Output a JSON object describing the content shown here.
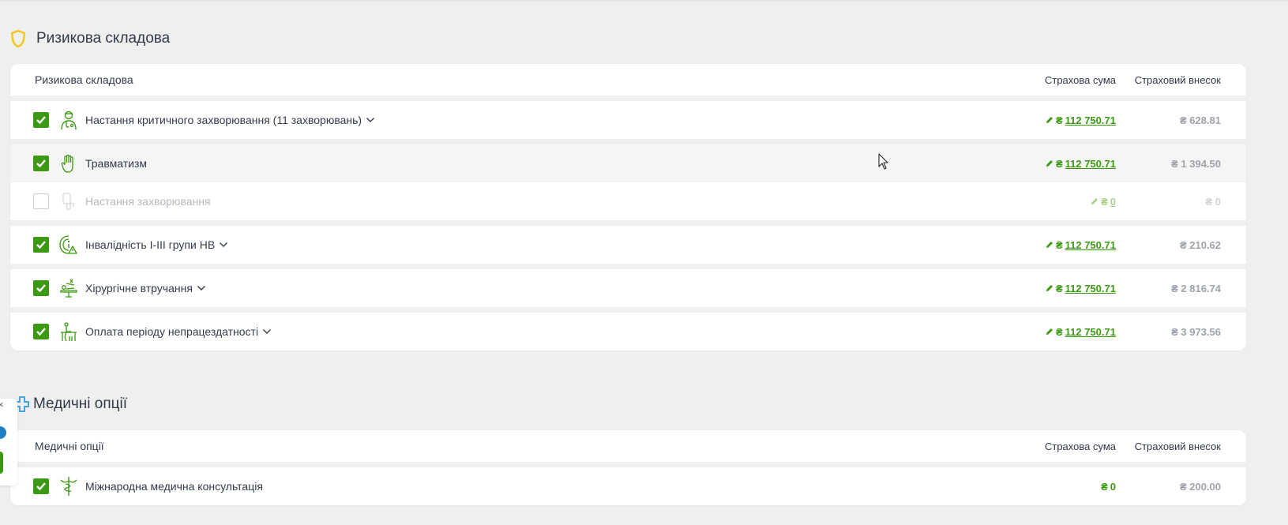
{
  "colors": {
    "accent": "#3b9a12",
    "muted": "#9ea3aa",
    "shield": "#f5c518",
    "cross": "#4aa3df"
  },
  "risk": {
    "title": "Ризикова складова",
    "header": {
      "name": "Ризикова складова",
      "sum": "Страхова сума",
      "fee": "Страховий внесок"
    },
    "rows": [
      {
        "label": "Настання критичного захворювання (11 захворювань)",
        "checked": true,
        "icon": "doctor-icon",
        "sum": "112 750.71",
        "fee": "628.81",
        "expandable": true
      },
      {
        "label": "Травматизм",
        "checked": true,
        "icon": "hand-icon",
        "sum": "112 750.71",
        "fee": "1 394.50",
        "expandable": false
      },
      {
        "label": "Настання захворювання",
        "checked": false,
        "icon": "medical-icon",
        "sum": "0",
        "fee": "0",
        "expandable": false
      },
      {
        "label": "Інвалідність I-III групи НВ",
        "checked": true,
        "icon": "disability-icon",
        "sum": "112 750.71",
        "fee": "210.62",
        "expandable": true
      },
      {
        "label": "Хірургічне втручання",
        "checked": true,
        "icon": "surgery-icon",
        "sum": "112 750.71",
        "fee": "2 816.74",
        "expandable": true
      },
      {
        "label": "Оплата періоду непрацездатності",
        "checked": true,
        "icon": "sick-leave-icon",
        "sum": "112 750.71",
        "fee": "3 973.56",
        "expandable": true
      }
    ]
  },
  "medical": {
    "title": "Медичні опції",
    "header": {
      "name": "Медичні опції",
      "sum": "Страхова сума",
      "fee": "Страховий внесок"
    },
    "rows": [
      {
        "label": "Міжнародна медична консультація",
        "checked": true,
        "icon": "caduceus-icon",
        "sum": "0",
        "fee": "200.00"
      }
    ]
  },
  "currency": "₴",
  "side_widget": {
    "close": "×"
  }
}
